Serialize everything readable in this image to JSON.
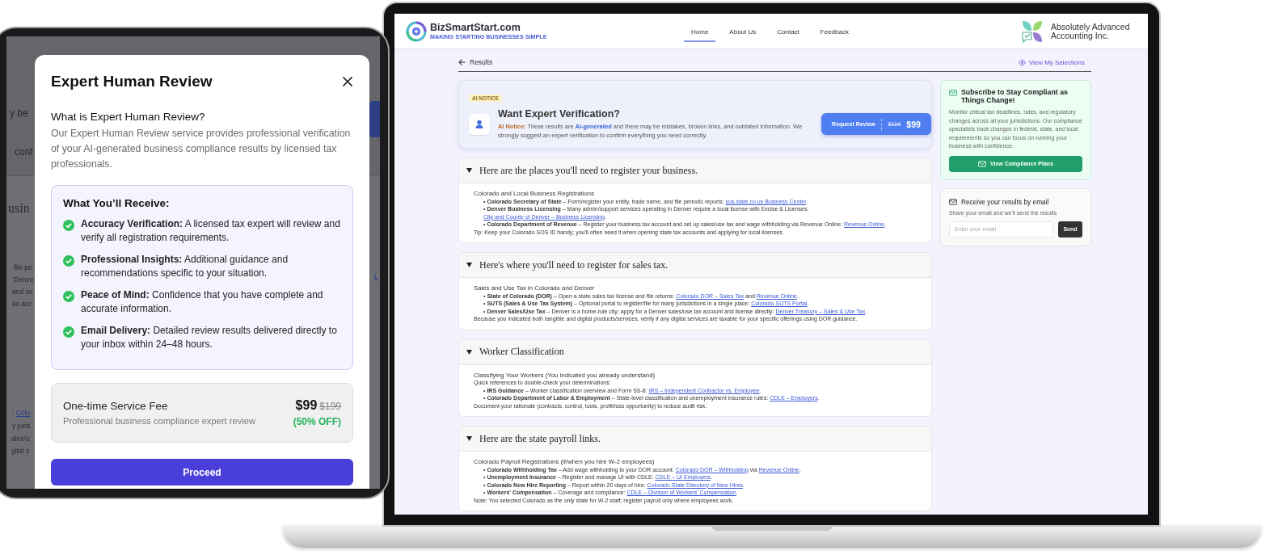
{
  "tablet": {
    "background_fragments": [
      {
        "kind": "large",
        "segments": [
          {
            "kind": "text",
            "text": "y be"
          }
        ]
      },
      {
        "kind": "large",
        "segments": [
          {
            "kind": "text",
            "text": "conf"
          }
        ]
      },
      {
        "kind": "heading",
        "segments": [
          {
            "kind": "text",
            "text": "usin"
          }
        ]
      },
      {
        "kind": "small",
        "segments": [
          {
            "kind": "text",
            "text": "file pe"
          }
        ]
      },
      {
        "kind": "small",
        "segments": [
          {
            "kind": "text",
            "text": "Denve"
          }
        ]
      },
      {
        "kind": "small",
        "segments": [
          {
            "kind": "text",
            "text": "and se"
          }
        ]
      },
      {
        "kind": "small",
        "segments": [
          {
            "kind": "text",
            "text": "ax acc"
          }
        ]
      },
      {
        "kind": "small",
        "segments": [
          {
            "kind": "text",
            "text": ": "
          },
          {
            "kind": "link",
            "text": "Colo"
          }
        ]
      },
      {
        "kind": "small",
        "segments": [
          {
            "kind": "text",
            "text": "y juris"
          }
        ]
      },
      {
        "kind": "small",
        "segments": [
          {
            "kind": "text",
            "text": "ales/u"
          }
        ]
      },
      {
        "kind": "small",
        "segments": [
          {
            "kind": "text",
            "text": "gital s"
          }
        ]
      },
      {
        "kind": "small",
        "segments": [
          {
            "kind": "link",
            "text": "L"
          }
        ]
      }
    ],
    "modal": {
      "title": "Expert Human Review",
      "question": "What is Expert Human Review?",
      "description": "Our Expert Human Review service provides professional verification of your AI-generated business compliance results by licensed tax professionals.",
      "benefits_title": "What You’ll Receive:",
      "benefits": [
        {
          "text": "**Accuracy Verification:** A licensed tax expert will review and verify all registration requirements."
        },
        {
          "text": "**Professional Insights:** Additional guidance and recommendations specific to your situation."
        },
        {
          "text": "**Peace of Mind:** Confidence that you have complete and accurate information."
        },
        {
          "text": "**Email Delivery:** Detailed review results delivered directly to your inbox within 24–48 hours."
        }
      ],
      "fee": {
        "title": "One-time Service Fee",
        "subtitle": "Professional business compliance expert review",
        "price": "$99",
        "old_price": "$199",
        "discount": "(50% OFF)"
      },
      "proceed": "Proceed"
    }
  },
  "laptop": {
    "brand": {
      "name": "BizSmartStart.com",
      "tagline": "MAKING STARTING BUSINESSES SIMPLE"
    },
    "nav": [
      {
        "label": "Home",
        "selected": true
      },
      {
        "label": "About Us",
        "selected": false
      },
      {
        "label": "Contact",
        "selected": false
      },
      {
        "label": "Feedback",
        "selected": false
      }
    ],
    "partner": "Absolutely Advanced Accounting Inc.",
    "back_label": "Results",
    "selections_link": "View My Selections",
    "notice": {
      "badge": "AI NOTICE",
      "title": "Want Expert Verification?",
      "body": "**AI Notice:** These results are **AI-generated** and there may be mistakes, broken links, and outdated information. We strongly suggest an expert verification to confirm everything you need correctly.",
      "button": "Request Review",
      "old_price": "$199",
      "price": "$99"
    },
    "sections": [
      {
        "title": "Here are the places you'll need to register your business.",
        "expanded": true,
        "lines": [
          {
            "kind": "heading",
            "segments": [
              {
                "kind": "text",
                "text": "Colorado and Local Business Registrations"
              }
            ]
          },
          {
            "kind": "bullet",
            "marker": "•",
            "label": "Colorado Secretary of State",
            "segments": [
              {
                "kind": "text",
                "text": "– Form/register your entity, trade name, and file periodic reports: "
              },
              {
                "kind": "link",
                "text": "sos.state.co.us Business Center"
              },
              {
                "kind": "text",
                "text": "."
              }
            ]
          },
          {
            "kind": "bullet",
            "marker": "•",
            "label": "Denver Business Licensing",
            "segments": [
              {
                "kind": "text",
                "text": "– Many admin/support services operating in Denver require a local license with Excise & Licenses: "
              },
              {
                "kind": "link",
                "text": "City and County of Denver – Business Licensing"
              },
              {
                "kind": "text",
                "text": "."
              }
            ]
          },
          {
            "kind": "bullet",
            "marker": "•",
            "label": "Colorado Department of Revenue",
            "segments": [
              {
                "kind": "text",
                "text": "– Register your business tax account and set up sales/use tax and wage withholding via Revenue Online: "
              },
              {
                "kind": "link",
                "text": "Revenue Online"
              },
              {
                "kind": "text",
                "text": "."
              }
            ]
          },
          {
            "kind": "text",
            "segments": [
              {
                "kind": "text",
                "text": "Tip: Keep your Colorado SOS ID handy; you'll often need it when opening state tax accounts and applying for local licenses."
              }
            ]
          }
        ]
      },
      {
        "title": "Here's where you'll need to register for sales tax.",
        "expanded": true,
        "lines": [
          {
            "kind": "heading",
            "segments": [
              {
                "kind": "text",
                "text": "Sales and Use Tax in Colorado and Denver"
              }
            ]
          },
          {
            "kind": "bullet",
            "marker": "•",
            "label": "State of Colorado (DOR)",
            "segments": [
              {
                "kind": "text",
                "text": "– Open a state sales tax license and file returns: "
              },
              {
                "kind": "link",
                "text": "Colorado DOR – Sales Tax"
              },
              {
                "kind": "text",
                "text": " and "
              },
              {
                "kind": "link",
                "text": "Revenue Online"
              },
              {
                "kind": "text",
                "text": "."
              }
            ]
          },
          {
            "kind": "bullet",
            "marker": "•",
            "label": "SUTS (Sales & Use Tax System)",
            "segments": [
              {
                "kind": "text",
                "text": "– Optional portal to register/file for many jurisdictions in a single place: "
              },
              {
                "kind": "link",
                "text": "Colorado SUTS Portal"
              },
              {
                "kind": "text",
                "text": "."
              }
            ]
          },
          {
            "kind": "bullet",
            "marker": "•",
            "label": "Denver Sales/Use Tax",
            "segments": [
              {
                "kind": "text",
                "text": "– Denver is a home-rule city; apply for a Denver sales/use tax account and license directly: "
              },
              {
                "kind": "link",
                "text": "Denver Treasury – Sales & Use Tax"
              },
              {
                "kind": "text",
                "text": "."
              }
            ]
          },
          {
            "kind": "text",
            "segments": [
              {
                "kind": "text",
                "text": "Because you indicated both tangible and digital products/services, verify if any digital services are taxable for your specific offerings using DOR guidance."
              }
            ]
          }
        ]
      },
      {
        "title": "Worker Classification",
        "expanded": true,
        "lines": [
          {
            "kind": "heading",
            "segments": [
              {
                "kind": "text",
                "text": "Classifying Your Workers (You indicated you already understand)"
              }
            ]
          },
          {
            "kind": "text",
            "segments": [
              {
                "kind": "text",
                "text": "Quick references to double-check your determinations:"
              }
            ]
          },
          {
            "kind": "bullet",
            "marker": "•",
            "label": "IRS Guidance",
            "segments": [
              {
                "kind": "text",
                "text": "– Worker classification overview and Form SS-8: "
              },
              {
                "kind": "link",
                "text": "IRS – Independent Contractor vs. Employee"
              },
              {
                "kind": "text",
                "text": "."
              }
            ]
          },
          {
            "kind": "bullet",
            "marker": "•",
            "label": "Colorado Department of Labor & Employment",
            "segments": [
              {
                "kind": "text",
                "text": "– State-level classification and unemployment insurance rules: "
              },
              {
                "kind": "link",
                "text": "CDLE – Employers"
              },
              {
                "kind": "text",
                "text": "."
              }
            ]
          },
          {
            "kind": "text",
            "segments": [
              {
                "kind": "text",
                "text": "Document your rationale (contracts, control, tools, profit/loss opportunity) to reduce audit risk."
              }
            ]
          }
        ]
      },
      {
        "title": "Here are the state payroll links.",
        "expanded": true,
        "lines": [
          {
            "kind": "heading",
            "segments": [
              {
                "kind": "text",
                "text": "Colorado Payroll Registrations (if/when you hire W-2 employees)"
              }
            ]
          },
          {
            "kind": "bullet",
            "marker": "•",
            "label": "Colorado Withholding Tax",
            "segments": [
              {
                "kind": "text",
                "text": "– Add wage withholding to your DOR account: "
              },
              {
                "kind": "link",
                "text": "Colorado DOR – Withholding"
              },
              {
                "kind": "text",
                "text": " via "
              },
              {
                "kind": "link",
                "text": "Revenue Online"
              },
              {
                "kind": "text",
                "text": "."
              }
            ]
          },
          {
            "kind": "bullet",
            "marker": "•",
            "label": "Unemployment Insurance",
            "segments": [
              {
                "kind": "text",
                "text": "– Register and manage UI with CDLE: "
              },
              {
                "kind": "link",
                "text": "CDLE – UI Employers"
              },
              {
                "kind": "text",
                "text": "."
              }
            ]
          },
          {
            "kind": "bullet",
            "marker": "•",
            "label": "Colorado New Hire Reporting",
            "segments": [
              {
                "kind": "text",
                "text": "– Report within 20 days of hire: "
              },
              {
                "kind": "link",
                "text": "Colorado State Directory of New Hires"
              },
              {
                "kind": "text",
                "text": "."
              }
            ]
          },
          {
            "kind": "bullet",
            "marker": "•",
            "label": "Workers' Compensation",
            "segments": [
              {
                "kind": "text",
                "text": "– Coverage and compliance: "
              },
              {
                "kind": "link",
                "text": "CDLE – Division of Workers' Compensation"
              },
              {
                "kind": "text",
                "text": "."
              }
            ]
          },
          {
            "kind": "text",
            "segments": [
              {
                "kind": "text",
                "text": "Note: You selected Colorado as the only state for W-2 staff; register payroll only where employees work."
              }
            ]
          }
        ]
      }
    ],
    "subscribe": {
      "title": "Subscribe to Stay Compliant as Things Change!",
      "body": "Monitor critical tax deadlines, rates, and regulatory changes across all your jurisdictions. Our compliance specialists track changes in federal, state, and local requirements so you can focus on running your business with confidence.",
      "button": "View Compliance Plans"
    },
    "email": {
      "title": "Receive your results by email",
      "subtitle": "Share your email and we'll send the results",
      "placeholder": "Enter your email",
      "button": "Send"
    }
  }
}
